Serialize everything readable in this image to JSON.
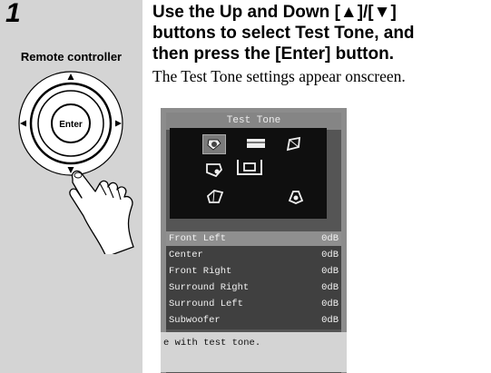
{
  "step": {
    "number": "1"
  },
  "remote": {
    "label": "Remote controller",
    "enter_label": "Enter"
  },
  "instruction": {
    "line1": "Use the Up and Down [▲]/[▼]",
    "line2": "buttons to select Test Tone, and",
    "line3": "then press the [Enter] button."
  },
  "description": "The Test Tone settings appear onscreen.",
  "osd": {
    "title": "Test Tone",
    "icons": [
      "front-left-speaker-icon",
      "center-speaker-icon",
      "front-right-speaker-icon",
      "surround-right-speaker-icon",
      "subwoofer-icon",
      "surround-left-speaker-icon",
      "listener-icon"
    ],
    "channels": [
      {
        "name": "Front Left",
        "value": "0dB",
        "selected": true
      },
      {
        "name": "Center",
        "value": "0dB",
        "selected": false
      },
      {
        "name": "Front Right",
        "value": "0dB",
        "selected": false
      },
      {
        "name": "Surround Right",
        "value": "0dB",
        "selected": false
      },
      {
        "name": "Surround Left",
        "value": "0dB",
        "selected": false
      },
      {
        "name": "Subwoofer",
        "value": "0dB",
        "selected": false
      }
    ],
    "footer": "e with test tone."
  },
  "colors": {
    "side_panel": "#d4d4d4",
    "osd_background": "#555555",
    "osd_selected_row": "#8f8f8f"
  }
}
